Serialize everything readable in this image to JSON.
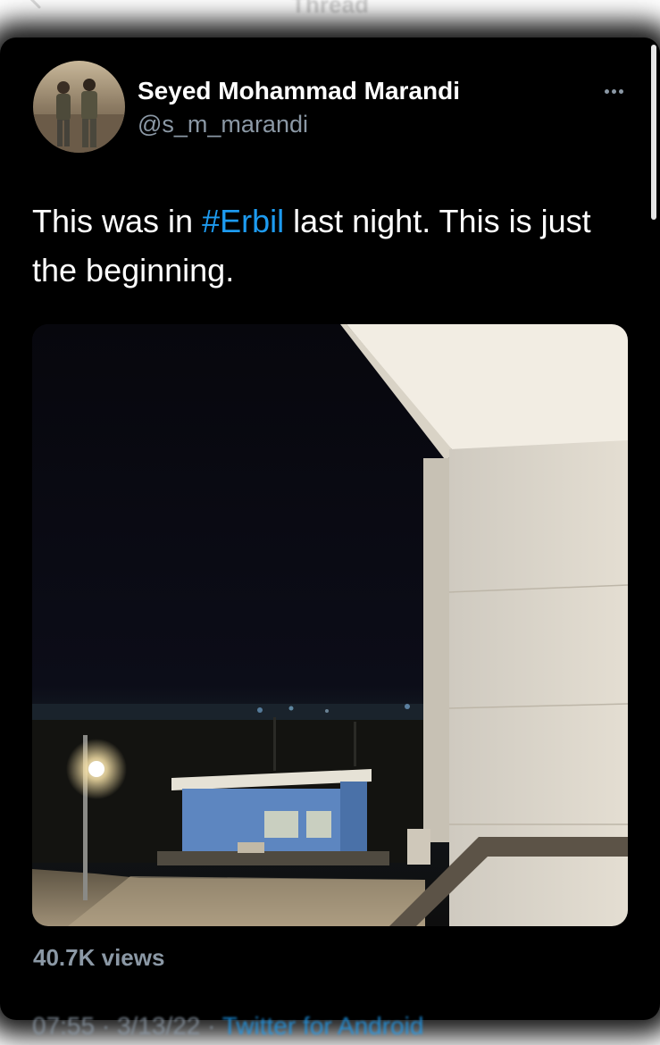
{
  "header": {
    "title": "Thread"
  },
  "tweet": {
    "author_name": "Seyed Mohammad Marandi",
    "author_handle": "@s_m_marandi",
    "text_before": "This was in ",
    "hashtag": "#Erbil",
    "text_after": " last night. This is just the beginning.",
    "views": "40.7K views",
    "time": "07:55 · 3/13/22 · ",
    "source": "Twitter for Android"
  },
  "colors": {
    "background": "#000000",
    "text": "#ffffff",
    "secondary": "#8b98a5",
    "accent": "#1d9bf0"
  },
  "icons": {
    "back": "back-arrow-icon",
    "more": "more-horizontal-icon"
  }
}
